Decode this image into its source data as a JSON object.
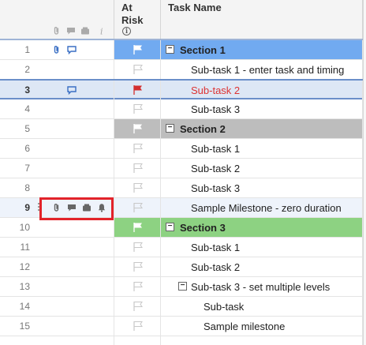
{
  "header": {
    "at_risk_label_1": "At",
    "at_risk_label_2": "Risk",
    "at_risk_info": "i",
    "task_name_label": "Task Name"
  },
  "rows": [
    {
      "num": "1",
      "task": "Section 1"
    },
    {
      "num": "2",
      "task": "Sub-task 1 - enter task and timing"
    },
    {
      "num": "3",
      "task": "Sub-task 2"
    },
    {
      "num": "4",
      "task": "Sub-task 3"
    },
    {
      "num": "5",
      "task": "Section 2"
    },
    {
      "num": "6",
      "task": "Sub-task 1"
    },
    {
      "num": "7",
      "task": "Sub-task 2"
    },
    {
      "num": "8",
      "task": "Sub-task 3"
    },
    {
      "num": "9",
      "task": "Sample Milestone - zero duration"
    },
    {
      "num": "10",
      "task": "Section 3"
    },
    {
      "num": "11",
      "task": "Sub-task 1"
    },
    {
      "num": "12",
      "task": "Sub-task 2"
    },
    {
      "num": "13",
      "task": "Sub-task 3 - set multiple levels"
    },
    {
      "num": "14",
      "task": "Sub-task"
    },
    {
      "num": "15",
      "task": "Sample milestone"
    }
  ],
  "colors": {
    "section1": "#71aaf0",
    "section2": "#bdbdbd",
    "section3": "#8dd282",
    "at_risk_flag": "#d32f2f",
    "highlight_box": "#e2232a"
  }
}
